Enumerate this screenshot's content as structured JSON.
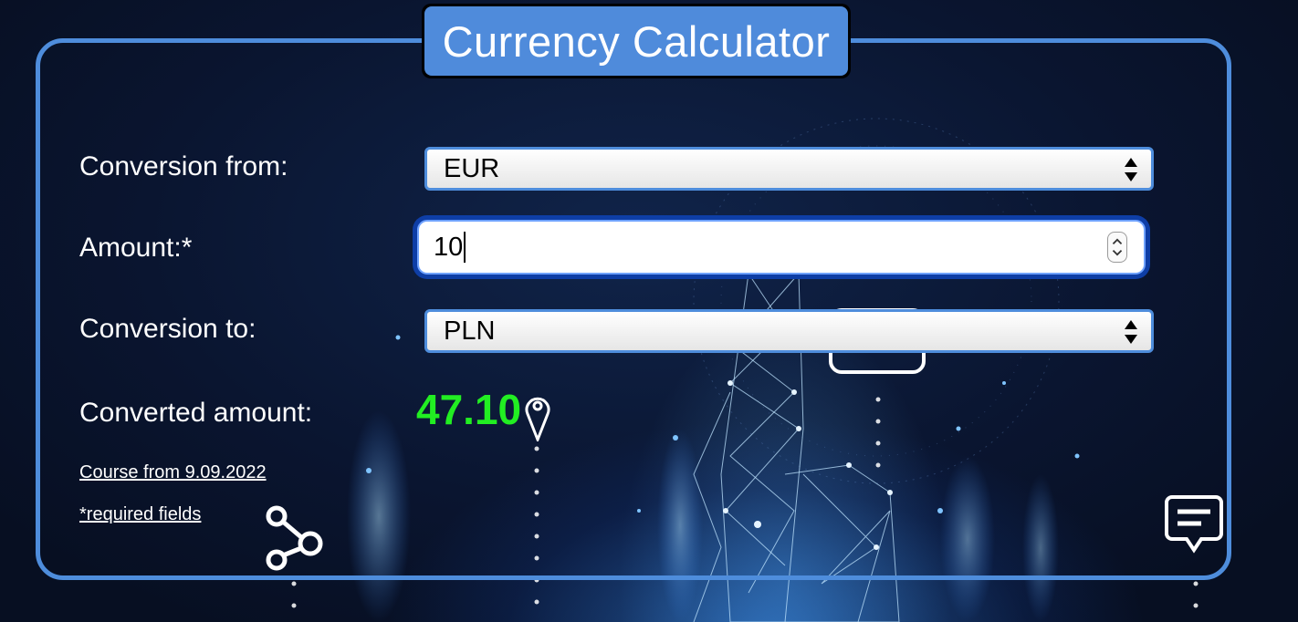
{
  "title": "Currency Calculator",
  "form": {
    "from_label": "Conversion from:",
    "from_value": "EUR",
    "amount_label": "Amount:*",
    "amount_value": "10",
    "to_label": "Conversion to:",
    "to_value": "PLN",
    "converted_label": "Converted amount:",
    "converted_value": "47.10"
  },
  "links": {
    "course": "Course from 9.09.2022",
    "required": "*required fields"
  },
  "icons": {
    "location": "location-pin-icon",
    "share": "share-nodes-icon",
    "message": "message-icon",
    "select_arrows": "updown-arrows-icon",
    "spinner": "number-spinner-icon"
  },
  "colors": {
    "accent": "#4f8bdb",
    "result": "#22ee22",
    "input_focus": "#0e3ea6"
  }
}
